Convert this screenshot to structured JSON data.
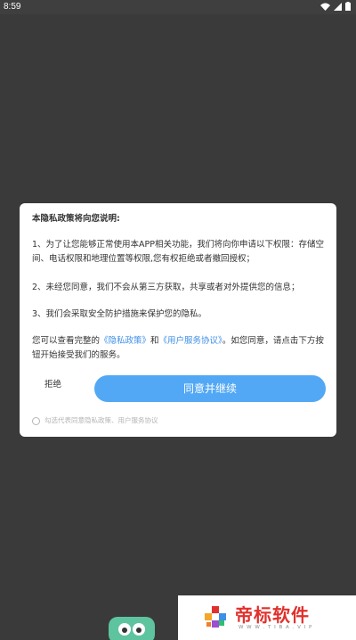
{
  "status_bar": {
    "time": "8:59"
  },
  "dialog": {
    "title": "本隐私政策将向您说明:",
    "para1": "1、为了让您能够正常使用本APP相关功能，我们将向你申请以下权限：存储空间、电话权限和地理位置等权限,您有权拒绝或者撤回授权；",
    "para2": "2、未经您同意，我们不会从第三方获取，共享或者对外提供您的信息；",
    "para3": "3、我们会采取安全防护措施来保护您的隐私。",
    "para4_prefix": "您可以查看完整的",
    "privacy_link": "《隐私政策》",
    "para4_and": "和",
    "agreement_link": "《用户服务协议》",
    "para4_suffix": "。如您同意，请点击下方按钮开始接受我们的服务。",
    "reject_label": "拒绝",
    "agree_label": "同意并继续",
    "consent_text": "勾选代表同意隐私政策、用户服务协议"
  },
  "watermark": {
    "brand": "帝标软件",
    "url": "W W W . T I B A . V I P"
  },
  "colors": {
    "overlay": "#3a3a3a",
    "accent": "#52a8f4",
    "link": "#3d8fe8",
    "brand_red": "#e0312d"
  }
}
